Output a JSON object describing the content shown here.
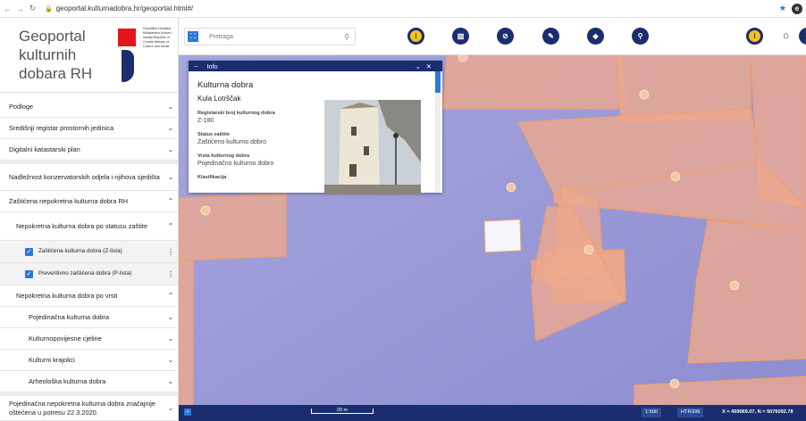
{
  "browser": {
    "url": "geoportal.kulturnadobra.hr/geoportal.html#/"
  },
  "logo": {
    "title": "Geoportal kulturnih dobara RH",
    "ministry": "Republika Hrvatska Ministarstvo kulture i medija Republic of Croatia Ministry of Culture and Media"
  },
  "menu": {
    "items": [
      {
        "label": "Podloge"
      },
      {
        "label": "Središnji registar prostornih jedinica"
      },
      {
        "label": "Digitalni katastarski plan"
      },
      {
        "label": "Nadležnost konzervatorskih odjela i njihova sjedišta"
      },
      {
        "label": "Zaštićena nepokretna kulturna dobra RH"
      },
      {
        "label": "Nepokretna kulturna dobra po statusu zaštite"
      },
      {
        "label": "Zaštićena kulturna dobra (Z-lista)"
      },
      {
        "label": "Preventivno zaštićena dobra (P-lista)"
      },
      {
        "label": "Nepokretna kulturna dobra po vrsti"
      },
      {
        "label": "Pojedinačna kulturna dobra"
      },
      {
        "label": "Kulturnopovijesne cjeline"
      },
      {
        "label": "Kulturni krajolici"
      },
      {
        "label": "Arheološka kulturna dobra"
      },
      {
        "label": "Pojedinačna nepokretna kulturna dobra značajnije oštećena u potresu 22.3.2020."
      }
    ]
  },
  "search": {
    "placeholder": "Pretraga"
  },
  "info": {
    "title": "Info",
    "heading": "Kulturna dobra",
    "name": "Kula Lotrščak",
    "fields": [
      {
        "key": "Registarski broj kulturnog dobra",
        "value": "Z-180"
      },
      {
        "key": "Status zaštite",
        "value": "Zaštićeno kulturno dobro"
      },
      {
        "key": "Vrsta kulturnog dobra",
        "value": "Pojedinačno kulturno dobro"
      },
      {
        "key": "Klasifikacija",
        "value": ""
      }
    ]
  },
  "bottom": {
    "scale": "20 m",
    "zoom": "1:500",
    "crs": "HTRS96",
    "coords": "X = 459069.07, N = 5076092.78"
  },
  "colors": {
    "navy": "#1b2d6e",
    "accent": "#2f78d8",
    "parcel": "#f0a788",
    "map": "#9b9ad8"
  }
}
